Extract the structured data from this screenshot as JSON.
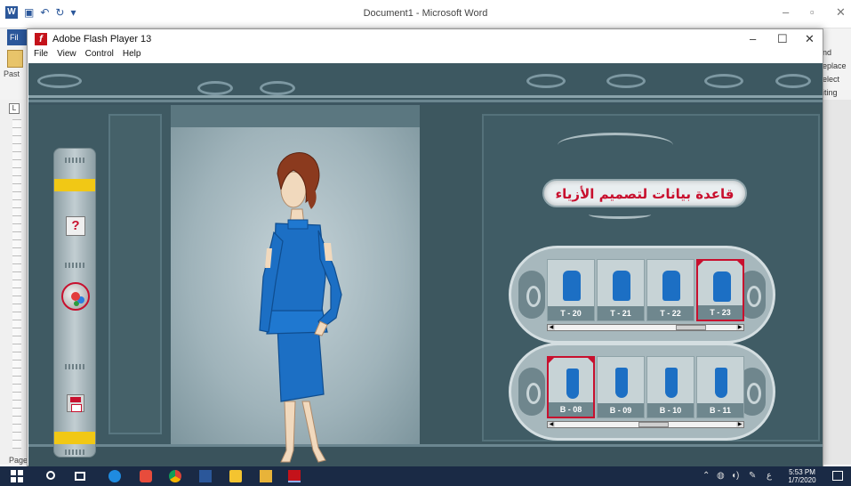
{
  "word": {
    "title": "Document1 - Microsoft Word",
    "file_tab": "Fil",
    "paste_label": "Past",
    "ribbon_right": [
      "nd",
      "eplace",
      "elect",
      "iting"
    ],
    "page_label": "Page",
    "ruler_corner": "L"
  },
  "flash": {
    "title": "Adobe Flash Player 13",
    "menu": [
      "File",
      "View",
      "Control",
      "Help"
    ],
    "window_controls": {
      "minimize": "–",
      "maximize": "☐",
      "close": "✕"
    }
  },
  "app": {
    "banner_title": "قاعدة بيانات لتصميم الأزياء",
    "toolbar": {
      "help_label": "?"
    },
    "tops": {
      "items": [
        {
          "code": "T - 20",
          "selected": false
        },
        {
          "code": "T - 21",
          "selected": false
        },
        {
          "code": "T - 22",
          "selected": false
        },
        {
          "code": "T - 23",
          "selected": true
        }
      ],
      "scroll_position": 0.8
    },
    "bottoms": {
      "items": [
        {
          "code": "B - 08",
          "selected": true
        },
        {
          "code": "B - 09",
          "selected": false
        },
        {
          "code": "B - 10",
          "selected": false
        },
        {
          "code": "B - 11",
          "selected": false
        }
      ],
      "scroll_position": 0.55
    },
    "garment_color": "#1c6fc4",
    "accent_color": "#c8102e"
  },
  "taskbar": {
    "time": "5:53 PM",
    "date": "1/7/2020",
    "lang": "ع"
  }
}
